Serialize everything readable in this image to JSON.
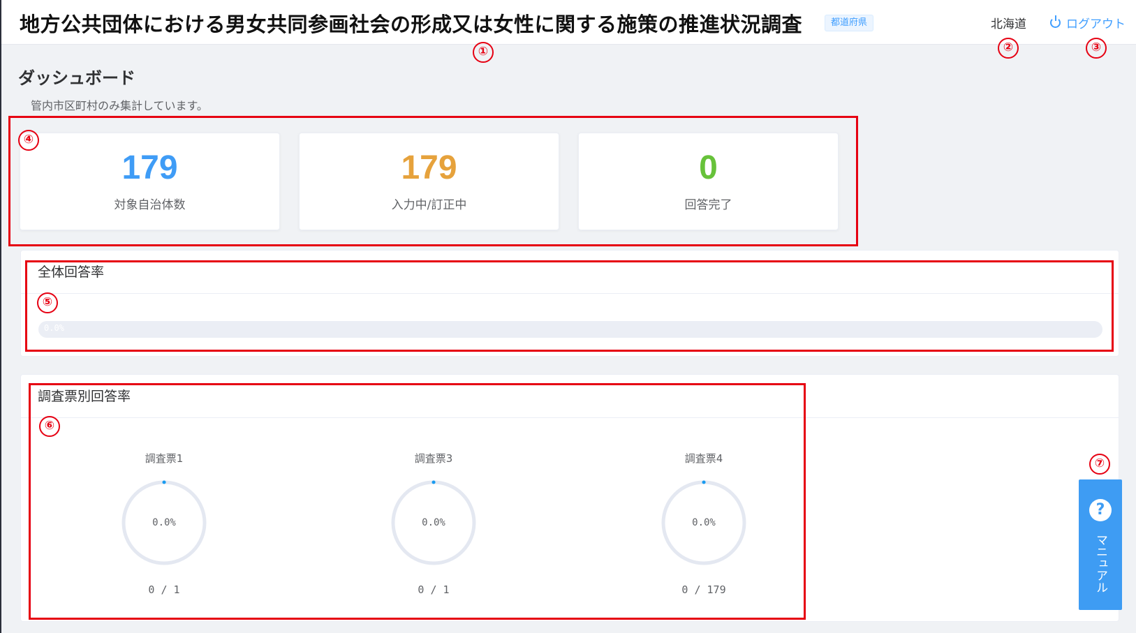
{
  "header": {
    "title": "地方公共団体における男女共同参画社会の形成又は女性に関する施策の推進状況調査",
    "badge": "都道府県",
    "user": "北海道",
    "logout_label": "ログアウト"
  },
  "dashboard": {
    "title": "ダッシュボード",
    "note": "管内市区町村のみ集計しています。"
  },
  "stats": [
    {
      "value": "179",
      "label": "対象自治体数",
      "color": "#3f9cf6"
    },
    {
      "value": "179",
      "label": "入力中/訂正中",
      "color": "#e6a23c"
    },
    {
      "value": "0",
      "label": "回答完了",
      "color": "#67c23a"
    }
  ],
  "overall": {
    "title": "全体回答率",
    "percent_text": "0.0%",
    "percent": 0
  },
  "by_survey": {
    "title": "調査票別回答率",
    "items": [
      {
        "name": "調査票1",
        "percent_text": "0.0%",
        "percent": 0,
        "count": "0 / 1"
      },
      {
        "name": "調査票3",
        "percent_text": "0.0%",
        "percent": 0,
        "count": "0 / 1"
      },
      {
        "name": "調査票4",
        "percent_text": "0.0%",
        "percent": 0,
        "count": "0 / 179"
      }
    ]
  },
  "manual": {
    "label": "マニュアル",
    "icon": "help-icon"
  },
  "annotations": [
    "①",
    "②",
    "③",
    "④",
    "⑤",
    "⑥",
    "⑦"
  ],
  "colors": {
    "accent": "#409eff",
    "annotation": "#e60012",
    "ring_track": "#e4e8f1"
  }
}
